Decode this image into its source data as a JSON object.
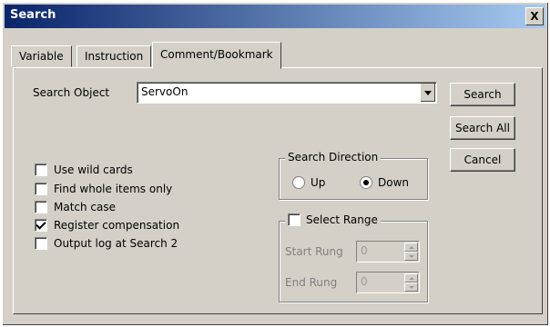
{
  "window": {
    "title": "Search",
    "close_label": "X"
  },
  "tabs": [
    {
      "label": "Variable"
    },
    {
      "label": "Instruction"
    },
    {
      "label": "Comment/Bookmark"
    }
  ],
  "search_object": {
    "label": "Search Object",
    "value": "ServoOn"
  },
  "buttons": {
    "search": "Search",
    "search_all": "Search All",
    "cancel": "Cancel"
  },
  "options": [
    {
      "label": "Use wild cards",
      "checked": false
    },
    {
      "label": "Find whole items only",
      "checked": false
    },
    {
      "label": "Match case",
      "checked": false
    },
    {
      "label": "Register compensation",
      "checked": true
    },
    {
      "label": "Output log at Search 2",
      "checked": false
    }
  ],
  "search_direction": {
    "label": "Search Direction",
    "up": "Up",
    "down": "Down",
    "selected": "Down"
  },
  "select_range": {
    "label": "Select Range",
    "checked": false,
    "start_label": "Start Rung",
    "start_value": "0",
    "end_label": "End Rung",
    "end_value": "0"
  }
}
